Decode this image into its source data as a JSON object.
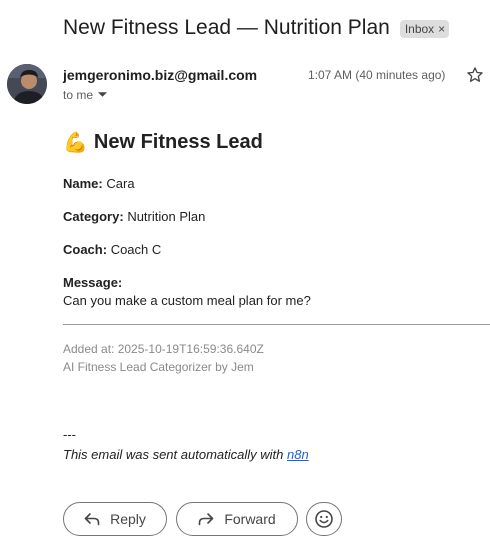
{
  "email": {
    "subject": "New Fitness Lead — Nutrition Plan",
    "label_badge": "Inbox",
    "label_remove": "×",
    "sender": "jemgeronimo.biz@gmail.com",
    "time": "1:07 AM (40 minutes ago)",
    "recipient": "to me"
  },
  "body": {
    "heading_emoji": "💪",
    "heading": "New Fitness Lead",
    "fields": [
      {
        "label": "Name:",
        "value": "Cara"
      },
      {
        "label": "Category:",
        "value": "Nutrition Plan"
      },
      {
        "label": "Coach:",
        "value": "Coach C"
      }
    ],
    "message_label": "Message:",
    "message": "Can you make a custom meal plan for me?",
    "added_at": "Added at: 2025-10-19T16:59:36.640Z",
    "categorizer": "AI Fitness Lead Categorizer by Jem",
    "dashes": "---",
    "auto_prefix": "This email was sent automatically with ",
    "auto_link": "n8n"
  },
  "actions": {
    "reply": "Reply",
    "forward": "Forward"
  },
  "icons": [
    "star-icon",
    "chevron-down-icon",
    "reply-icon",
    "forward-icon",
    "emoji-icon",
    "flexed-biceps-icon"
  ],
  "colors": {
    "link": "#1a5fd6",
    "badge_bg": "#dddddd"
  }
}
